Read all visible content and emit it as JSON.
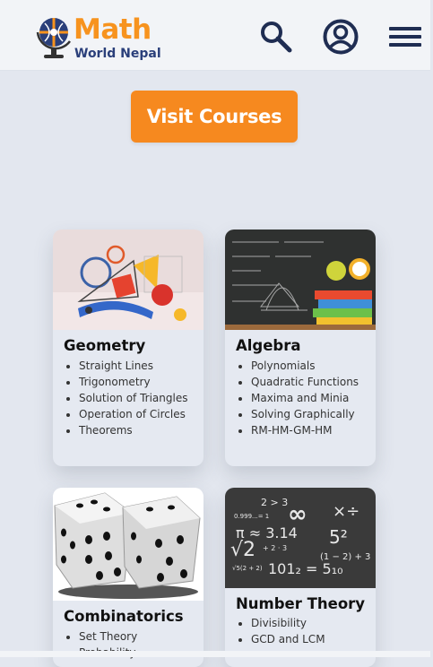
{
  "header": {
    "logo_title": "Math",
    "logo_subtitle": "World Nepal",
    "brand_orange": "#f7931e",
    "brand_navy": "#2a3f7a",
    "icons": [
      "globe-logo-icon",
      "search-icon",
      "account-icon",
      "hamburger-menu-icon"
    ]
  },
  "cta": {
    "label": "Visit Courses",
    "color": "#f6891f"
  },
  "courses": [
    {
      "title": "Geometry",
      "topics": [
        "Straight Lines",
        "Trigonometry",
        "Solution of Triangles",
        "Operation of Circles",
        "Theorems"
      ]
    },
    {
      "title": "Algebra",
      "topics": [
        "Polynomials",
        "Quadratic Functions",
        "Maxima and Minia",
        "Solving Graphically",
        "RM-HM-GM-HM"
      ]
    },
    {
      "title": "Combinatorics",
      "topics": [
        "Set Theory",
        "Probability"
      ]
    },
    {
      "title": "Number Theory",
      "topics": [
        "Divisibility",
        "GCD and LCM"
      ]
    }
  ]
}
